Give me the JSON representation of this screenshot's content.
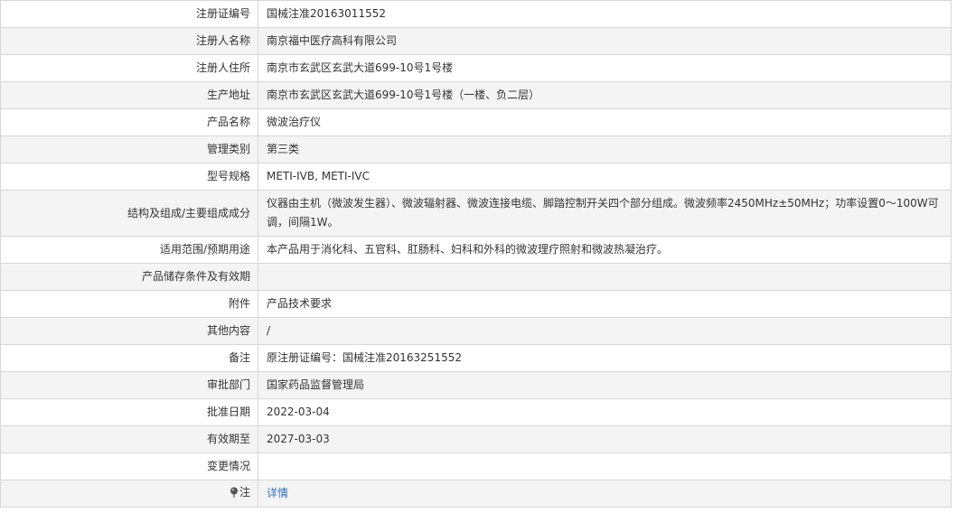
{
  "rows": [
    {
      "label": "注册证编号",
      "value": "国械注准20163011552"
    },
    {
      "label": "注册人名称",
      "value": "南京福中医疗高科有限公司"
    },
    {
      "label": "注册人住所",
      "value": "南京市玄武区玄武大道699-10号1号楼"
    },
    {
      "label": "生产地址",
      "value": "南京市玄武区玄武大道699-10号1号楼（一楼、负二层）"
    },
    {
      "label": "产品名称",
      "value": "微波治疗仪"
    },
    {
      "label": "管理类别",
      "value": "第三类"
    },
    {
      "label": "型号规格",
      "value": "METI-IVB, METI-IVC"
    },
    {
      "label": "结构及组成/主要组成成分",
      "value": "仪器由主机（微波发生器）、微波辐射器、微波连接电缆、脚踏控制开关四个部分组成。微波频率2450MHz±50MHz；功率设置0～100W可调，间隔1W。"
    },
    {
      "label": "适用范围/预期用途",
      "value": "本产品用于消化科、五官科、肛肠科、妇科和外科的微波理疗照射和微波热凝治疗。"
    },
    {
      "label": "产品储存条件及有效期",
      "value": ""
    },
    {
      "label": "附件",
      "value": "产品技术要求"
    },
    {
      "label": "其他内容",
      "value": "/"
    },
    {
      "label": "备注",
      "value": "原注册证编号：国械注准20163251552"
    },
    {
      "label": "审批部门",
      "value": "国家药品监督管理局"
    },
    {
      "label": "批准日期",
      "value": "2022-03-04"
    },
    {
      "label": "有效期至",
      "value": "2027-03-03"
    },
    {
      "label": "变更情况",
      "value": ""
    }
  ],
  "note": {
    "label": "注",
    "link_text": "详情",
    "icon": "pin-icon"
  },
  "colors": {
    "link": "#2f6fb5",
    "border": "#d6d6d6",
    "stripe": "#f4f4f4"
  }
}
